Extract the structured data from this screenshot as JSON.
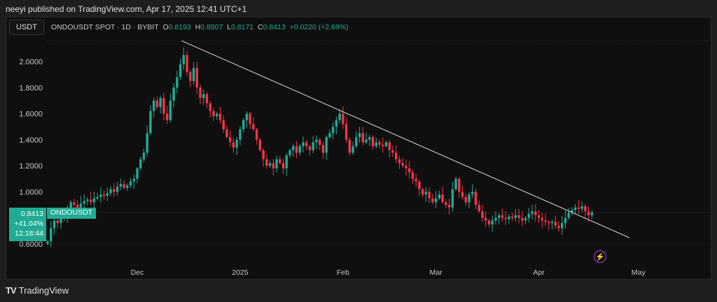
{
  "header": {
    "published": "neeyi published on TradingView.com, Apr 17, 2025 12:41 UTC+1"
  },
  "toolbar": {
    "currency": "USDT"
  },
  "legend": {
    "symbol": "ONDOUSDT SPOT · 1D · BYBIT",
    "o_label": "O",
    "o": "0.8193",
    "h_label": "H",
    "h": "0.8507",
    "l_label": "L",
    "l": "0.8171",
    "c_label": "C",
    "c": "0.8413",
    "change": "+0.0220 (+2.69%)"
  },
  "price_label": {
    "price": "0.8413",
    "change_pct": "+41.04%",
    "countdown": "12:18:44",
    "symbol": "ONDOUSDT"
  },
  "colors": {
    "up": "#22ab94",
    "down": "#f23645",
    "trendline": "#d9d9d9",
    "alert": "#b33fd8"
  },
  "chart_data": {
    "type": "candlestick",
    "start_date": "2024-11-04",
    "first_open": 0.6,
    "closes": [
      0.62,
      0.72,
      0.78,
      0.76,
      0.8,
      0.82,
      0.86,
      0.92,
      0.9,
      0.88,
      0.91,
      0.93,
      0.94,
      0.92,
      0.95,
      0.96,
      0.98,
      0.97,
      0.99,
      1.02,
      1.0,
      1.04,
      1.06,
      1.03,
      1.05,
      1.08,
      1.1,
      1.18,
      1.25,
      1.3,
      1.45,
      1.62,
      1.7,
      1.65,
      1.72,
      1.6,
      1.55,
      1.7,
      1.8,
      1.88,
      1.98,
      2.05,
      1.92,
      1.85,
      1.95,
      1.8,
      1.72,
      1.75,
      1.68,
      1.62,
      1.58,
      1.6,
      1.55,
      1.48,
      1.42,
      1.38,
      1.34,
      1.4,
      1.48,
      1.55,
      1.6,
      1.52,
      1.48,
      1.4,
      1.32,
      1.25,
      1.2,
      1.22,
      1.18,
      1.25,
      1.22,
      1.18,
      1.28,
      1.32,
      1.35,
      1.3,
      1.35,
      1.38,
      1.35,
      1.32,
      1.38,
      1.4,
      1.36,
      1.3,
      1.42,
      1.45,
      1.5,
      1.55,
      1.6,
      1.52,
      1.4,
      1.3,
      1.35,
      1.42,
      1.45,
      1.38,
      1.4,
      1.42,
      1.35,
      1.38,
      1.36,
      1.35,
      1.38,
      1.32,
      1.3,
      1.25,
      1.22,
      1.2,
      1.18,
      1.15,
      1.1,
      1.08,
      1.02,
      0.98,
      1.0,
      0.95,
      0.92,
      0.95,
      0.98,
      0.92,
      0.9,
      0.88,
      1.02,
      1.1,
      1.0,
      0.96,
      0.92,
      0.98,
      1.0,
      0.9,
      0.85,
      0.8,
      0.78,
      0.75,
      0.78,
      0.8,
      0.82,
      0.8,
      0.79,
      0.81,
      0.8,
      0.82,
      0.8,
      0.78,
      0.8,
      0.83,
      0.85,
      0.82,
      0.8,
      0.78,
      0.77,
      0.76,
      0.77,
      0.74,
      0.72,
      0.76,
      0.8,
      0.84,
      0.86,
      0.88,
      0.87,
      0.89,
      0.85,
      0.82,
      0.8413
    ],
    "y_ticks": [
      "2.0000",
      "1.8000",
      "1.6000",
      "1.4000",
      "1.2000",
      "1.0000",
      "0.6000"
    ],
    "y_tick_values": [
      2.0,
      1.8,
      1.6,
      1.4,
      1.2,
      1.0,
      0.6
    ],
    "x_ticks": [
      "Dec",
      "2025",
      "Feb",
      "Mar",
      "Apr",
      "May"
    ],
    "x_tick_day_index": [
      27,
      58,
      89,
      117,
      148,
      178
    ],
    "ylim": [
      0.53,
      2.3
    ],
    "last_price": 0.8413,
    "trendline": {
      "from": {
        "day": 40.3,
        "price": 2.16
      },
      "to": {
        "day": 175.3,
        "price": 0.648
      }
    }
  },
  "footer": {
    "brand": "TradingView",
    "brand_mark": "17"
  }
}
